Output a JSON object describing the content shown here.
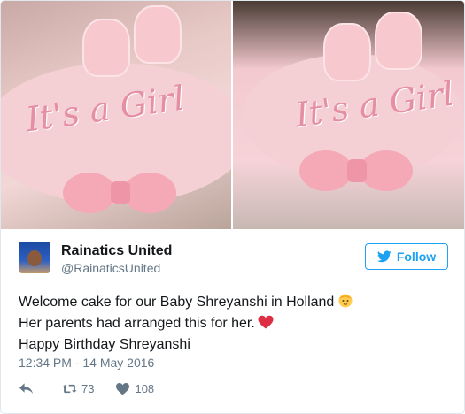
{
  "media": {
    "left_photo": {
      "cake_text": "It's a Girl"
    },
    "right_photo": {
      "cake_text": "It's a Girl"
    }
  },
  "author": {
    "name": "Rainatics United",
    "handle": "@RainaticsUnited"
  },
  "follow_button": {
    "label": "Follow"
  },
  "tweet": {
    "line1": "Welcome cake for our Baby Shreyanshi in Holland",
    "line2": "Her parents had arranged this for her.",
    "line3": "Happy Birthday Shreyanshi",
    "emoji1": "baby-emoji",
    "emoji2": "red-heart-emoji"
  },
  "timestamp": "12:34 PM - 14 May 2016",
  "actions": {
    "retweets": "73",
    "likes": "108"
  },
  "colors": {
    "accent": "#1da1f2",
    "muted": "#657786",
    "heart": "#e0245e"
  }
}
